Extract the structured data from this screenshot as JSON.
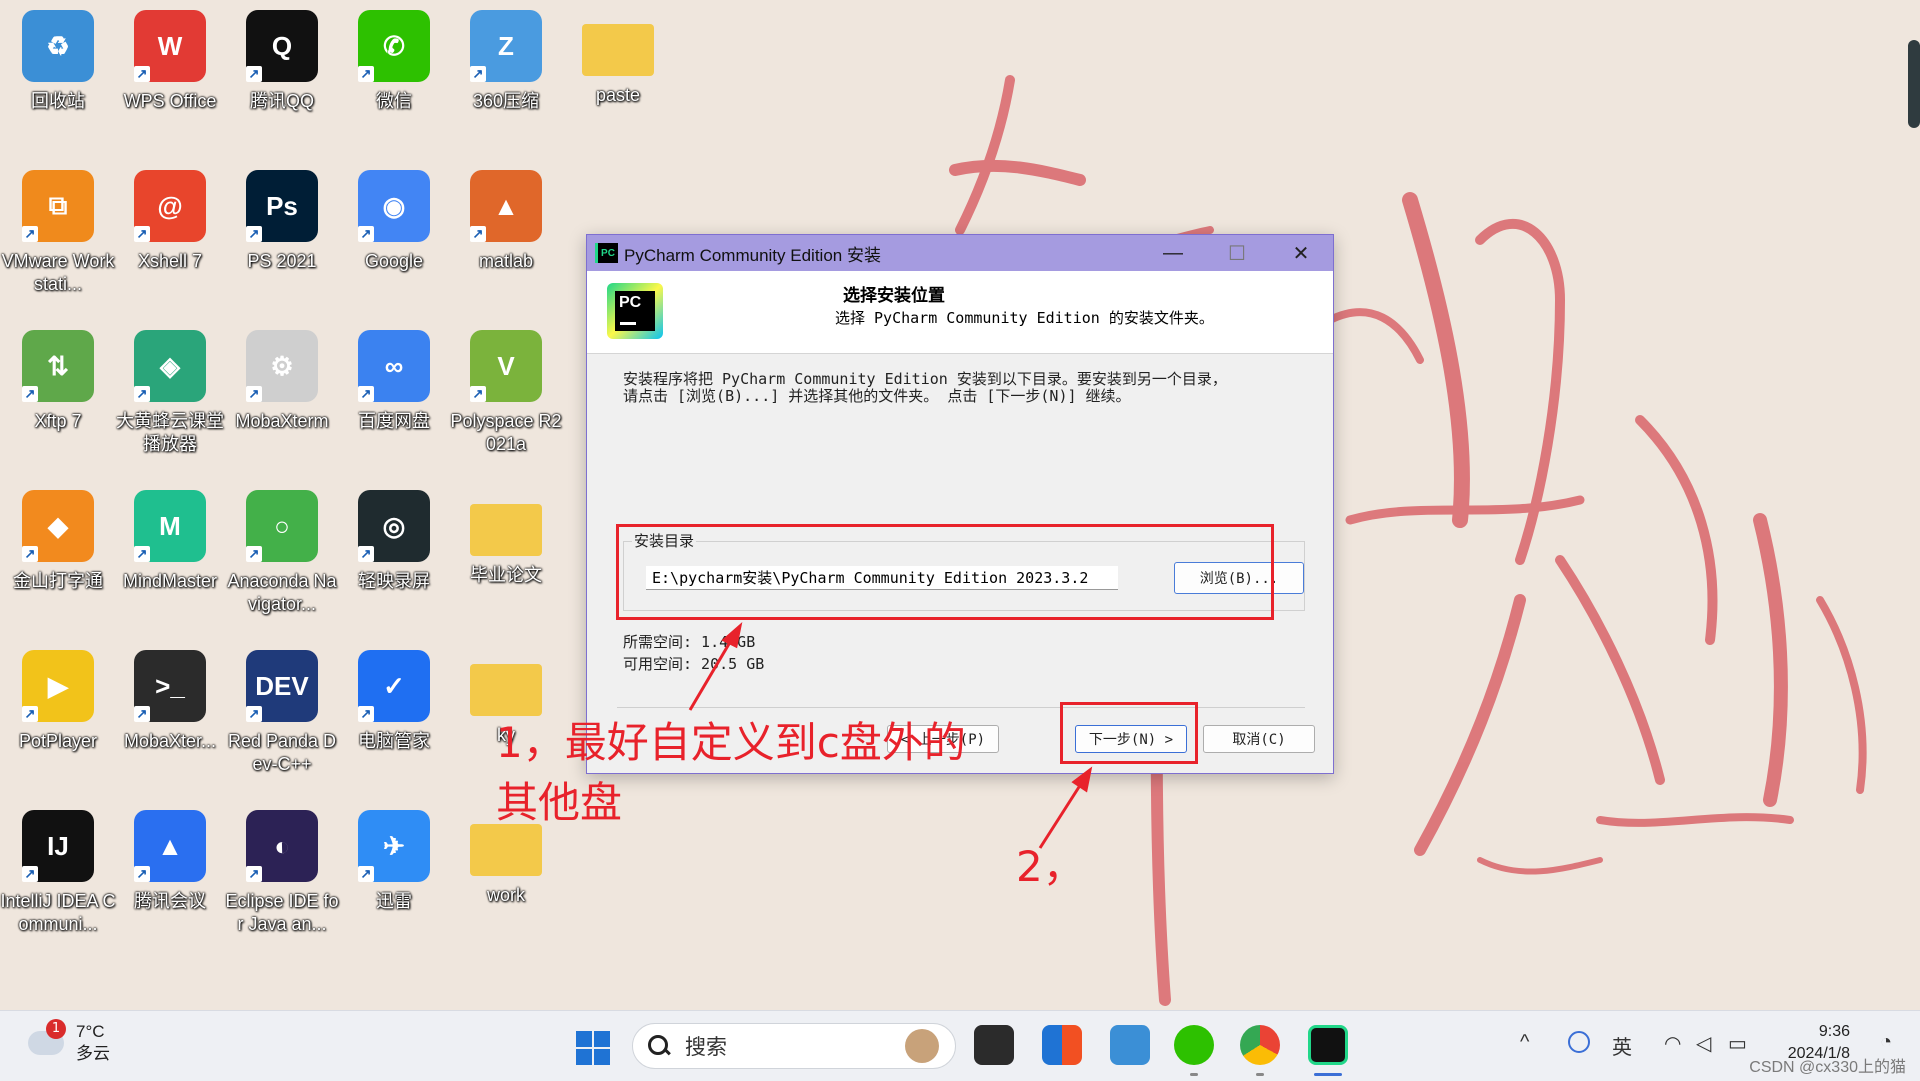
{
  "desktop": {
    "icons": [
      {
        "label": "回收站",
        "color": "#3b8fd6",
        "glyph": "♻"
      },
      {
        "label": "WPS Office",
        "color": "#e23a34",
        "glyph": "W"
      },
      {
        "label": "腾讯QQ",
        "color": "#111111",
        "glyph": "Q"
      },
      {
        "label": "微信",
        "color": "#2dc100",
        "glyph": "✆"
      },
      {
        "label": "360压缩",
        "color": "#4a9be0",
        "glyph": "Z"
      },
      {
        "label": "paste",
        "color": "#f3c94a",
        "glyph": ""
      },
      {
        "label": "VMware Workstati...",
        "color": "#f08a1c",
        "glyph": "⧉"
      },
      {
        "label": "Xshell 7",
        "color": "#e8452c",
        "glyph": "@"
      },
      {
        "label": "PS 2021",
        "color": "#001e36",
        "glyph": "Ps"
      },
      {
        "label": "Google",
        "color": "#4285f4",
        "glyph": "◉"
      },
      {
        "label": "matlab",
        "color": "#e0672a",
        "glyph": "▲"
      },
      {
        "label": "Xftp 7",
        "color": "#5fa84a",
        "glyph": "⇅"
      },
      {
        "label": "大黄蜂云课堂播放器",
        "color": "#2aa57a",
        "glyph": "◈"
      },
      {
        "label": "MobaXterm",
        "color": "#cfcfcf",
        "glyph": "⚙"
      },
      {
        "label": "百度网盘",
        "color": "#3b82f0",
        "glyph": "∞"
      },
      {
        "label": "Polyspace R2021a",
        "color": "#7bb33c",
        "glyph": "V"
      },
      {
        "label": "金山打字通",
        "color": "#f28a1e",
        "glyph": "◆"
      },
      {
        "label": "MindMaster",
        "color": "#1fbf8f",
        "glyph": "M"
      },
      {
        "label": "Anaconda Navigator...",
        "color": "#43b049",
        "glyph": "○"
      },
      {
        "label": "轻映录屏",
        "color": "#1f2b2f",
        "glyph": "◎"
      },
      {
        "label": "毕业论文",
        "color": "#f3c94a",
        "glyph": ""
      },
      {
        "label": "PotPlayer",
        "color": "#f2c31a",
        "glyph": "▶"
      },
      {
        "label": "MobaXter...",
        "color": "#2b2b2b",
        "glyph": ">_"
      },
      {
        "label": "Red Panda Dev-C++",
        "color": "#1f3a7a",
        "glyph": "DEV"
      },
      {
        "label": "电脑管家",
        "color": "#1f6ff2",
        "glyph": "✓"
      },
      {
        "label": "ky",
        "color": "#f3c94a",
        "glyph": ""
      },
      {
        "label": "IntelliJ IDEA Communi...",
        "color": "#111111",
        "glyph": "IJ"
      },
      {
        "label": "腾讯会议",
        "color": "#2a6ff0",
        "glyph": "▲"
      },
      {
        "label": "Eclipse IDE for Java an...",
        "color": "#2c2255",
        "glyph": "◐"
      },
      {
        "label": "迅雷",
        "color": "#2f8df5",
        "glyph": "✈"
      },
      {
        "label": "work",
        "color": "#f3c94a",
        "glyph": ""
      }
    ]
  },
  "dialog": {
    "window_title": "PyCharm Community Edition 安装",
    "app_icon_text": "PC",
    "minimize": "—",
    "maximize": "☐",
    "close": "✕",
    "header_title": "选择安装位置",
    "header_subtitle": "选择 PyCharm Community Edition 的安装文件夹。",
    "description_line1": "安装程序将把 PyCharm Community Edition 安装到以下目录。要安装到另一个目录，",
    "description_line2": "请点击 [浏览(B)...] 并选择其他的文件夹。 点击 [下一步(N)] 继续。",
    "group_label": "安装目录",
    "install_dir": "E:\\pycharm安装\\PyCharm Community Edition 2023.3.2",
    "browse_label": "浏览(B)...",
    "space_required": "所需空间: 1.4 GB",
    "space_available": "可用空间: 20.5 GB",
    "back_label": "< 上一步(P)",
    "next_label": "下一步(N) >",
    "cancel_label": "取消(C)"
  },
  "annotations": {
    "note1_line1": "1，最好自定义到c盘外的",
    "note1_line2": "其他盘",
    "note2": "2，",
    "color": "#e8222b"
  },
  "taskbar": {
    "weather_badge": "1",
    "temperature": "7°C",
    "weather": "多云",
    "search_placeholder": "搜索",
    "tray_chevron": "^",
    "ime": "英",
    "time": "9:36",
    "date": "2024/1/8",
    "watermark": "CSDN @cx330上的猫"
  }
}
